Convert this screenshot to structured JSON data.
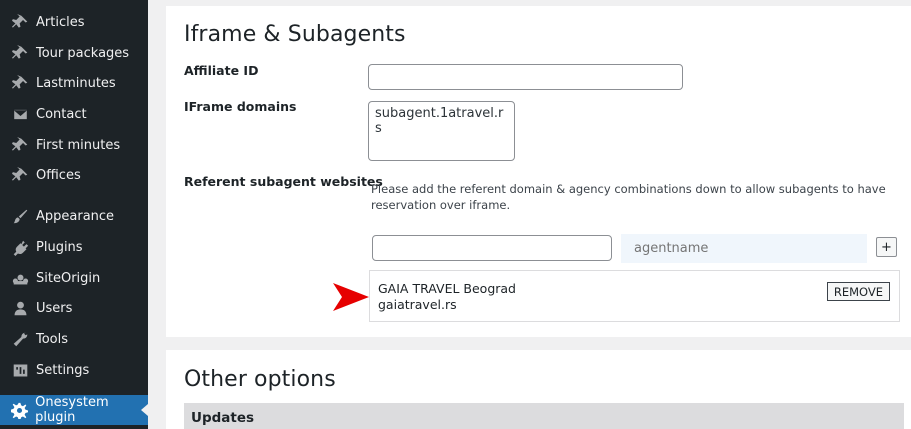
{
  "sidebar": {
    "items": [
      {
        "label": "Articles",
        "icon": "pin-icon"
      },
      {
        "label": "Tour packages",
        "icon": "pin-icon"
      },
      {
        "label": "Lastminutes",
        "icon": "pin-icon"
      },
      {
        "label": "Contact",
        "icon": "envelope-icon"
      },
      {
        "label": "First minutes",
        "icon": "pin-icon"
      },
      {
        "label": "Offices",
        "icon": "pin-icon"
      },
      {
        "label": "Appearance",
        "icon": "brush-icon"
      },
      {
        "label": "Plugins",
        "icon": "plug-icon"
      },
      {
        "label": "SiteOrigin",
        "icon": "siteorigin-icon"
      },
      {
        "label": "Users",
        "icon": "user-icon"
      },
      {
        "label": "Tools",
        "icon": "wrench-icon"
      },
      {
        "label": "Settings",
        "icon": "settings-icon"
      },
      {
        "label": "Onesystem plugin",
        "icon": "gear-icon",
        "active": true
      }
    ]
  },
  "iframe_section": {
    "title": "Iframe & Subagents",
    "affiliate_label": "Affiliate ID",
    "affiliate_value": "",
    "domains_label": "IFrame domains",
    "domains_value": "subagent.1atravel.rs",
    "referent_label": "Referent subagent websites",
    "referent_note": "Please add the referent domain & agency combinations down to allow subagents to have reservation over iframe.",
    "domain_input_value": "",
    "agent_placeholder": "agentname",
    "plus_label": "+",
    "entry": {
      "name": "GAIA TRAVEL Beograd",
      "domain": "gaiatravel.rs",
      "remove_label": "REMOVE"
    }
  },
  "other_section": {
    "title": "Other options",
    "updates_label": "Updates"
  },
  "colors": {
    "sidebar_bg": "#1d2327",
    "active_bg": "#2271b1",
    "arrow_red": "#e60000"
  }
}
